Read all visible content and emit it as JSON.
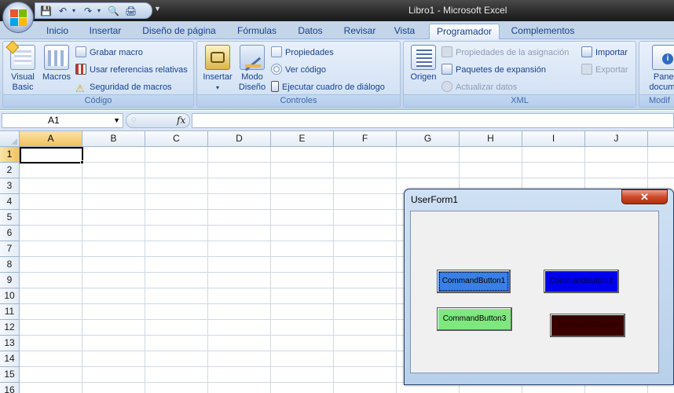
{
  "window": {
    "title": "Libro1 - Microsoft Excel"
  },
  "quick_access": {
    "icons": [
      "save-icon",
      "undo-icon",
      "redo-icon",
      "print-preview-icon",
      "print-icon"
    ]
  },
  "tabs": [
    {
      "label": "Inicio"
    },
    {
      "label": "Insertar"
    },
    {
      "label": "Diseño de página"
    },
    {
      "label": "Fórmulas"
    },
    {
      "label": "Datos"
    },
    {
      "label": "Revisar"
    },
    {
      "label": "Vista"
    },
    {
      "label": "Programador"
    },
    {
      "label": "Complementos"
    }
  ],
  "active_tab": "Programador",
  "ribbon": {
    "codigo": {
      "label": "Código",
      "visual_basic": "Visual Basic",
      "visual_basic_l1": "Visual",
      "visual_basic_l2": "Basic",
      "macros": "Macros",
      "grabar_macro": "Grabar macro",
      "usar_referencias": "Usar referencias relativas",
      "seguridad": "Seguridad de macros"
    },
    "controles": {
      "label": "Controles",
      "insertar": "Insertar",
      "modo_l1": "Modo",
      "modo_l2": "Diseño",
      "propiedades": "Propiedades",
      "ver_codigo": "Ver código",
      "ejecutar": "Ejecutar cuadro de diálogo"
    },
    "xml": {
      "label": "XML",
      "origen": "Origen",
      "propiedades_asignacion": "Propiedades de la asignación",
      "paquetes": "Paquetes de expansión",
      "actualizar": "Actualizar datos",
      "importar": "Importar",
      "exportar": "Exportar"
    },
    "modificar": {
      "label": "Modif",
      "panel_l1": "Panel",
      "panel_l2": "docume"
    }
  },
  "formula_bar": {
    "name_box": "A1",
    "fx": "fx",
    "value": ""
  },
  "columns": [
    "A",
    "B",
    "C",
    "D",
    "E",
    "F",
    "G",
    "H",
    "I",
    "J"
  ],
  "rows": [
    "1",
    "2",
    "3",
    "4",
    "5",
    "6",
    "7",
    "8",
    "9",
    "10",
    "11",
    "12",
    "13",
    "14",
    "15",
    "16"
  ],
  "userform": {
    "title": "UserForm1",
    "close": "✕",
    "buttons": [
      {
        "label": "CommandButton1",
        "bg": "#3a7fe6",
        "fg": "#000000"
      },
      {
        "label": "CommandButton2",
        "bg": "#0000ee",
        "fg": "#00004a"
      },
      {
        "label": "CommandButton3",
        "bg": "#7ee87e",
        "fg": "#000000"
      },
      {
        "label": "CommandButton4",
        "bg": "#3a0000",
        "fg": "#2a0000"
      }
    ]
  },
  "colors": {
    "accent": "#15428b",
    "selected_header": "#f1c15f"
  }
}
